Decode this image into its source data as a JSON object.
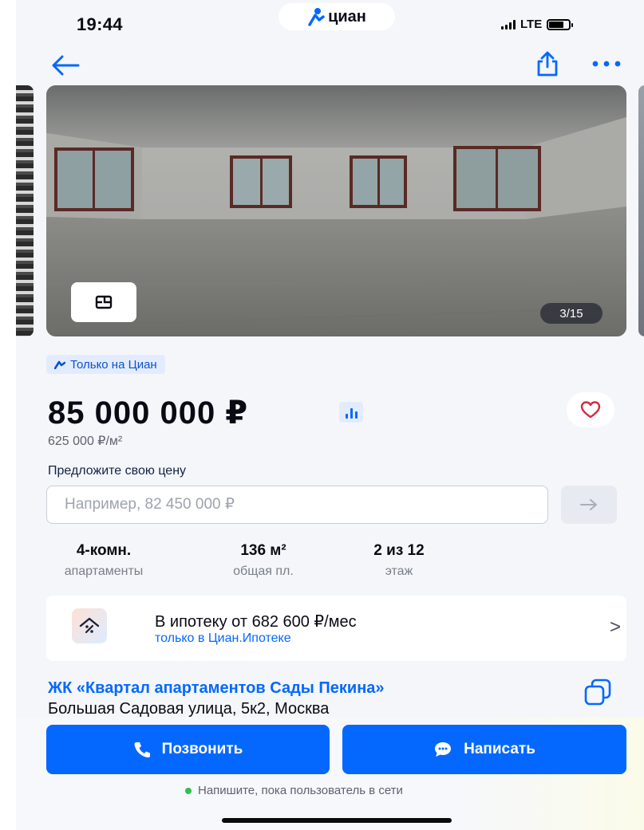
{
  "status_bar": {
    "time": "19:44",
    "brand": "циан",
    "network": "LTE",
    "battery_level": 0.75
  },
  "nav": {
    "back_icon": "arrow-left-icon",
    "share_icon": "share-icon",
    "more_icon": "more-dots-icon"
  },
  "gallery": {
    "counter": "3/15",
    "plan_icon": "floor-plan-icon"
  },
  "badge": {
    "label": "Только на Циан"
  },
  "price": {
    "value": "85 000 000 ₽",
    "per_meter": "625 000 ₽/м²",
    "favorite_icon": "heart-icon"
  },
  "offer": {
    "label": "Предложите свою цену",
    "placeholder": "Например, 82 450 000 ₽",
    "submit_icon": "arrow-right-icon"
  },
  "params": [
    {
      "value": "4-комн.",
      "label": "апартаменты"
    },
    {
      "value": "136 м²",
      "label": "общая пл."
    },
    {
      "value": "2 из 12",
      "label": "этаж"
    }
  ],
  "mortgage": {
    "title": "В ипотеку от 682 600 ₽/мес",
    "subtitle": "только в Циан.Ипотеке",
    "chevron": ">"
  },
  "complex": {
    "name": "ЖК «Квартал апартаментов Сады Пекина»",
    "address": "Большая Садовая улица, 5к2, Москва"
  },
  "actions": {
    "call": "Позвонить",
    "write": "Написать",
    "online_note": "Напишите, пока пользователь в сети"
  },
  "colors": {
    "accent": "#0468ff",
    "badge_bg": "#e3ecff",
    "favorite": "#d42a3c",
    "online": "#2fbf4d"
  }
}
